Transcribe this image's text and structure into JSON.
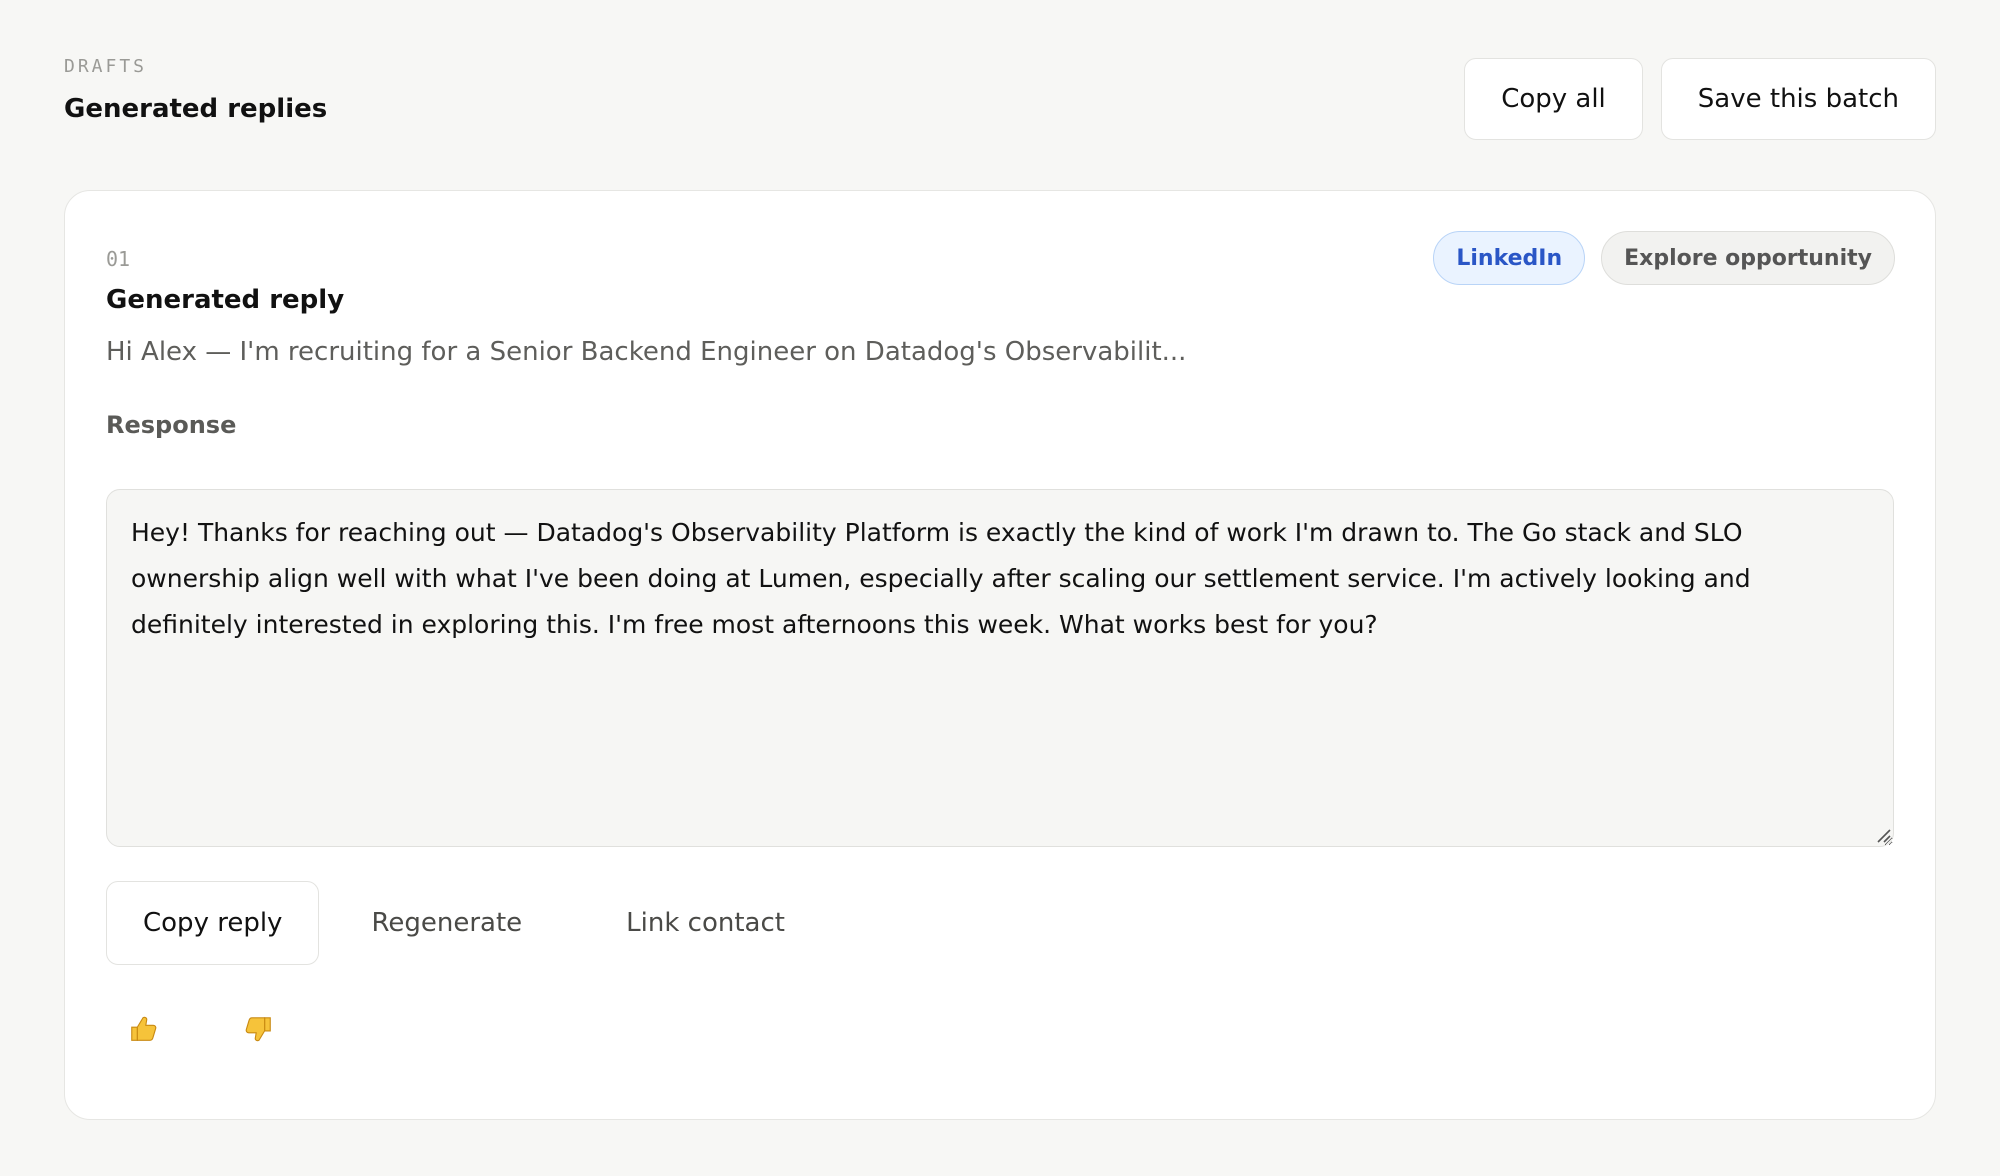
{
  "header": {
    "eyebrow": "DRAFTS",
    "title": "Generated replies",
    "copy_all_label": "Copy all",
    "save_batch_label": "Save this batch"
  },
  "card": {
    "index": "01",
    "title": "Generated reply",
    "tags": {
      "channel": "LinkedIn",
      "stage": "Explore opportunity"
    },
    "preview": "Hi Alex — I'm recruiting for a Senior Backend Engineer on Datadog's Observabilit...",
    "response_label": "Response",
    "response_text": "Hey! Thanks for reaching out — Datadog's Observability Platform is exactly the kind of work I'm drawn to. The Go stack and SLO ownership align well with what I've been doing at Lumen, especially after scaling our settlement service. I'm actively looking and definitely interested in exploring this. I'm free most afternoons this week. What works best for you?",
    "actions": {
      "copy_reply": "Copy reply",
      "regenerate": "Regenerate",
      "link_contact": "Link contact"
    },
    "feedback": {
      "thumbs_up_icon": "thumbs-up-icon",
      "thumbs_down_icon": "thumbs-down-icon"
    }
  },
  "colors": {
    "page_bg": "#f7f7f5",
    "card_bg": "#ffffff",
    "linkedin_tag_text": "#2a56c6",
    "linkedin_tag_bg": "#eaf3ff",
    "thumb_yellow": "#f6c33a"
  }
}
